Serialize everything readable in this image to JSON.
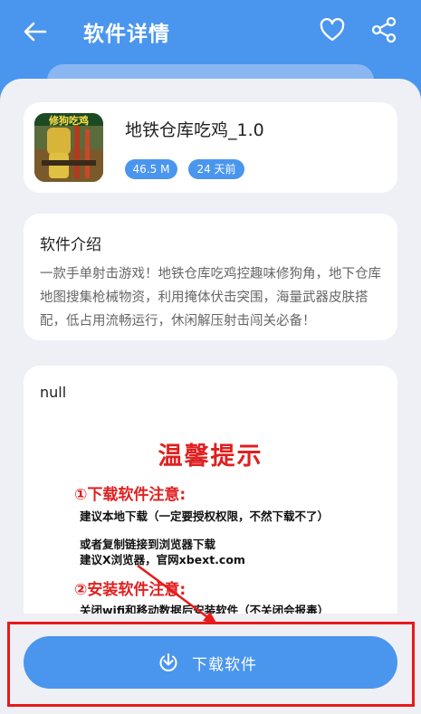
{
  "header": {
    "title": "软件详情",
    "icons": [
      "back-arrow-icon",
      "heart-icon",
      "share-icon"
    ]
  },
  "app": {
    "name": "地铁仓库吃鸡_1.0",
    "icon_text": "修狗吃鸡",
    "size": "46.5 M",
    "date": "24 天前"
  },
  "intro": {
    "title": "软件介绍",
    "text": "一款手单射击游戏！地铁仓库吃鸡控趣味修狗角，地下仓库地图搜集枪械物资，利用掩体伏击突围，海量武器皮肤搭配，低占用流畅运行，休闲解压射击闯关必备！"
  },
  "notice": {
    "null_text": "null",
    "heading": "温馨提示",
    "section1": "①下载软件注意:",
    "line1": "建议本地下载（一定要授权权限，不然下载不了）",
    "line2": "或者复制链接到浏览器下载",
    "line3": "建议X浏览器，官网xbext.com",
    "section2": "②安装软件注意:",
    "line4": "关闭wifi和移动数据后安装软件（不关闭会报毒）"
  },
  "download": {
    "label": "下载软件"
  },
  "colors": {
    "primary": "#4a96ee",
    "background": "#eef0f5",
    "warning": "#e02020",
    "highlight": "#e81a1a"
  }
}
